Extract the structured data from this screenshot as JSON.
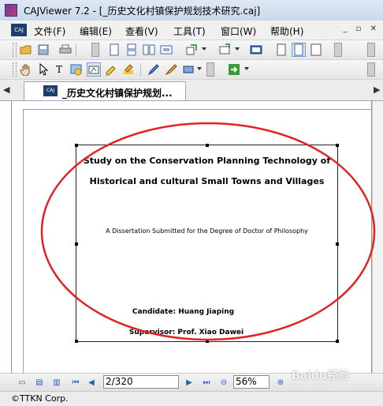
{
  "window": {
    "title": "CAJViewer 7.2 - [_历史文化村镇保护规划技术研究.caj]"
  },
  "menubar": {
    "doc_icon_label": "CAJ",
    "items": [
      {
        "label": "文件(F)"
      },
      {
        "label": "编辑(E)"
      },
      {
        "label": "查看(V)"
      },
      {
        "label": "工具(T)"
      },
      {
        "label": "窗口(W)"
      },
      {
        "label": "帮助(H)"
      }
    ]
  },
  "toolbar1": {
    "icons": [
      "open-folder-icon",
      "save-icon",
      "print-icon",
      "single-page-icon",
      "continuous-page-icon",
      "facing-page-icon",
      "zoom-fit-icon",
      "rotate-icon",
      "fullscreen-icon",
      "page-view-icon",
      "page-layout-icon",
      "page-width-icon"
    ]
  },
  "toolbar2": {
    "icons": [
      "hand-tool-icon",
      "select-arrow-icon",
      "text-select-icon",
      "image-select-icon",
      "snapshot-icon",
      "annotate-icon",
      "highlight-icon",
      "pencil-icon",
      "eraser-icon",
      "rectangle-icon",
      "go-arrow-icon"
    ]
  },
  "tabs": [
    {
      "label": "_历史文化村镇保护规划...",
      "icon_label": "CAJ",
      "active": true
    }
  ],
  "document": {
    "title_line1": "Study on the Conservation Planning Technology of",
    "title_line2": "Historical and cultural Small Towns and Villages",
    "subtitle": "A Dissertation Submitted for the Degree of Doctor of Philosophy",
    "candidate": "Candidate: Huang Jiaping",
    "supervisor": "Supervisor: Prof. Xiao Dawei"
  },
  "annotation": {
    "color": "#e02424",
    "shape": "ellipse"
  },
  "navigation": {
    "page_value": "2/320",
    "zoom_value": "56%"
  },
  "status": {
    "text": "©TTKN Corp."
  },
  "watermark": "Baidu经验"
}
